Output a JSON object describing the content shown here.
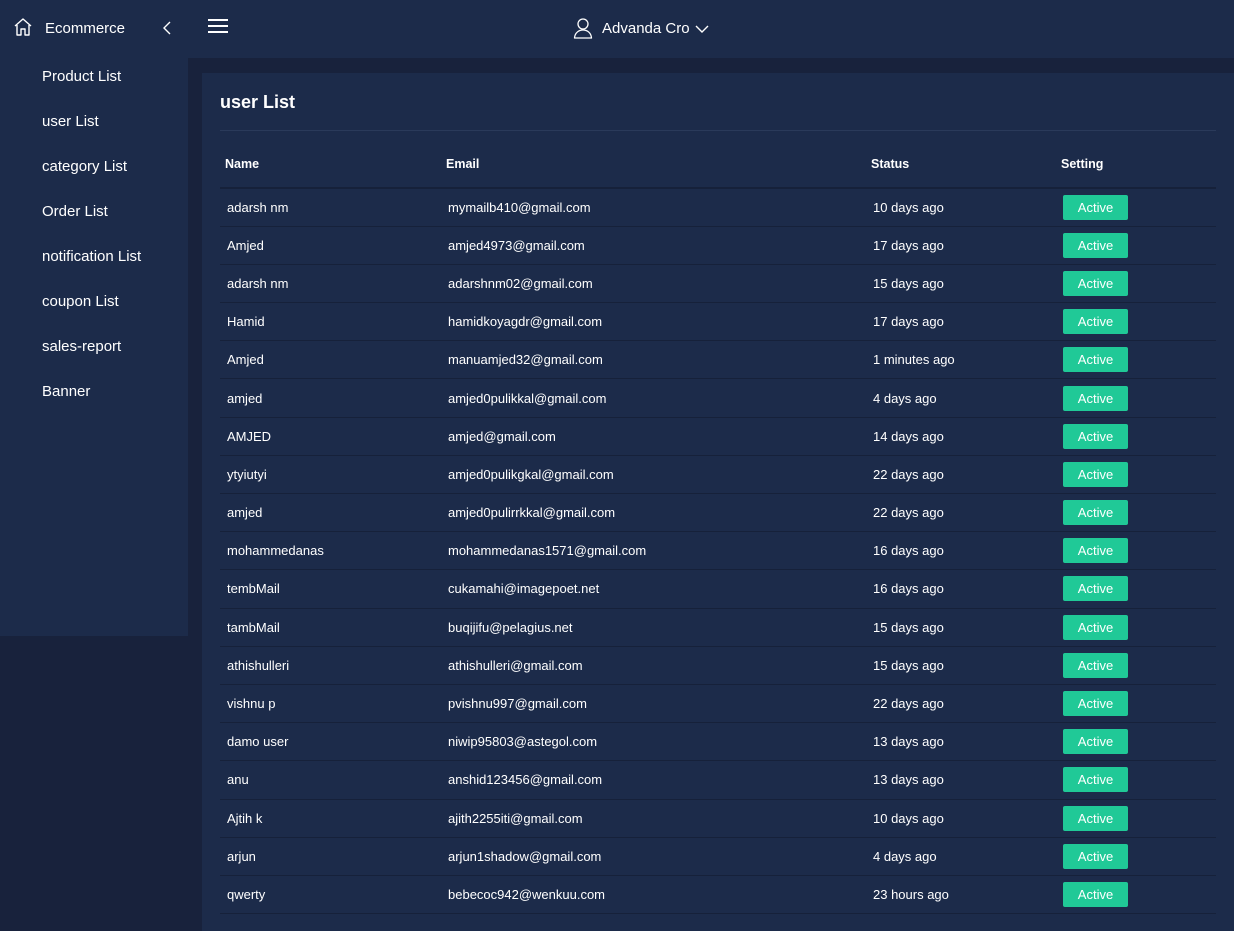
{
  "sidebar": {
    "brand": "Ecommerce",
    "items": [
      {
        "label": "Product List"
      },
      {
        "label": "user List"
      },
      {
        "label": "category List"
      },
      {
        "label": "Order List"
      },
      {
        "label": "notification List"
      },
      {
        "label": "coupon List"
      },
      {
        "label": "sales-report"
      },
      {
        "label": "Banner"
      }
    ]
  },
  "header": {
    "user_name": "Advanda Cro"
  },
  "main": {
    "title": "user List",
    "columns": [
      "Name",
      "Email",
      "Status",
      "Setting"
    ],
    "rows": [
      {
        "name": "adarsh nm",
        "email": "mymailb410@gmail.com",
        "status": "10 days ago",
        "setting": "Active"
      },
      {
        "name": "Amjed",
        "email": "amjed4973@gmail.com",
        "status": "17 days ago",
        "setting": "Active"
      },
      {
        "name": "adarsh nm",
        "email": "adarshnm02@gmail.com",
        "status": "15 days ago",
        "setting": "Active"
      },
      {
        "name": "Hamid",
        "email": "hamidkoyagdr@gmail.com",
        "status": "17 days ago",
        "setting": "Active"
      },
      {
        "name": "Amjed",
        "email": "manuamjed32@gmail.com",
        "status": "1 minutes ago",
        "setting": "Active"
      },
      {
        "name": "amjed",
        "email": "amjed0pulikkal@gmail.com",
        "status": "4 days ago",
        "setting": "Active"
      },
      {
        "name": "AMJED",
        "email": "amjed@gmail.com",
        "status": "14 days ago",
        "setting": "Active"
      },
      {
        "name": "ytyiutyi",
        "email": "amjed0pulikgkal@gmail.com",
        "status": "22 days ago",
        "setting": "Active"
      },
      {
        "name": "amjed",
        "email": "amjed0pulirrkkal@gmail.com",
        "status": "22 days ago",
        "setting": "Active"
      },
      {
        "name": "mohammedanas",
        "email": "mohammedanas1571@gmail.com",
        "status": "16 days ago",
        "setting": "Active"
      },
      {
        "name": "tembMail",
        "email": "cukamahi@imagepoet.net",
        "status": "16 days ago",
        "setting": "Active"
      },
      {
        "name": "tambMail",
        "email": "buqijifu@pelagius.net",
        "status": "15 days ago",
        "setting": "Active"
      },
      {
        "name": "athishulleri",
        "email": "athishulleri@gmail.com",
        "status": "15 days ago",
        "setting": "Active"
      },
      {
        "name": "vishnu p",
        "email": "pvishnu997@gmail.com",
        "status": "22 days ago",
        "setting": "Active"
      },
      {
        "name": "damo user",
        "email": "niwip95803@astegol.com",
        "status": "13 days ago",
        "setting": "Active"
      },
      {
        "name": "anu",
        "email": "anshid123456@gmail.com",
        "status": "13 days ago",
        "setting": "Active"
      },
      {
        "name": "Ajtih k",
        "email": "ajith2255iti@gmail.com",
        "status": "10 days ago",
        "setting": "Active"
      },
      {
        "name": "arjun",
        "email": "arjun1shadow@gmail.com",
        "status": "4 days ago",
        "setting": "Active"
      },
      {
        "name": "qwerty",
        "email": "bebecoc942@wenkuu.com",
        "status": "23 hours ago",
        "setting": "Active"
      }
    ]
  },
  "colors": {
    "background": "#18223c",
    "panel": "#1c2b4a",
    "accent": "#20c997"
  },
  "icons": {
    "brand": "home-icon",
    "collapse": "chevron-left-icon",
    "menu": "hamburger-menu-icon",
    "user": "user-icon",
    "dropdown": "chevron-down-icon"
  }
}
